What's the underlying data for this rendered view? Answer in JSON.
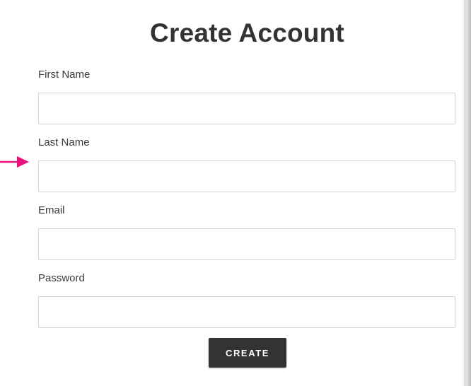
{
  "form": {
    "title": "Create Account",
    "fields": [
      {
        "label": "First Name",
        "value": "",
        "placeholder": ""
      },
      {
        "label": "Last Name",
        "value": "",
        "placeholder": ""
      },
      {
        "label": "Email",
        "value": "",
        "placeholder": ""
      },
      {
        "label": "Password",
        "value": "",
        "placeholder": ""
      }
    ],
    "submit_label": "CREATE"
  },
  "annotation": {
    "arrow_color": "#e8127c",
    "arrow_target": "Last Name"
  },
  "colors": {
    "button_bg": "#333333",
    "text": "#333333",
    "input_border": "#d3d3d3"
  }
}
